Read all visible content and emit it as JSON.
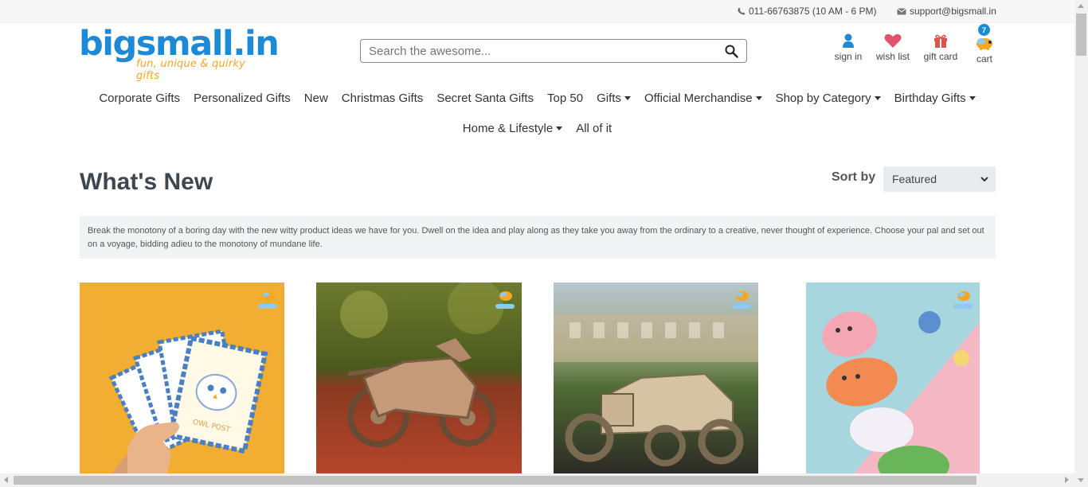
{
  "topbar": {
    "phone": "011-66763875 (10 AM - 6 PM)",
    "email": "support@bigsmall.in"
  },
  "logo": {
    "name": "bigsmall.in",
    "tagline": "fun, unique & quirky gifts"
  },
  "search": {
    "placeholder": "Search the awesome..."
  },
  "header_icons": {
    "sign_in": "sign in",
    "wish_list": "wish list",
    "gift_card": "gift card",
    "cart": "cart",
    "cart_count": "7"
  },
  "nav": {
    "row1": [
      {
        "label": "Corporate Gifts",
        "dropdown": false
      },
      {
        "label": "Personalized Gifts",
        "dropdown": false
      },
      {
        "label": "New",
        "dropdown": false
      },
      {
        "label": "Christmas Gifts",
        "dropdown": false
      },
      {
        "label": "Secret Santa Gifts",
        "dropdown": false
      },
      {
        "label": "Top 50",
        "dropdown": false
      },
      {
        "label": "Gifts",
        "dropdown": true
      },
      {
        "label": "Official Merchandise",
        "dropdown": true
      },
      {
        "label": "Shop by Category",
        "dropdown": true
      },
      {
        "label": "Birthday Gifts",
        "dropdown": true
      }
    ],
    "row2": [
      {
        "label": "Home & Lifestyle",
        "dropdown": true
      },
      {
        "label": "All of it",
        "dropdown": false
      }
    ]
  },
  "page": {
    "title": "What's New",
    "sort_label": "Sort by",
    "sort_value": "Featured",
    "description": "Break the monotony of a boring day with the new witty product ideas we have for you. Dwell on the idea and play along as they take you away from the ordinary to a creative, never thought of experience. Choose your pal and set out on a voyage, bidding adieu to the monotony of mundane life."
  },
  "products": [
    {
      "image": "postcards-owl-post",
      "card_text": "OWL POST"
    },
    {
      "image": "wooden-motorcycle-model"
    },
    {
      "image": "wooden-vintage-car-model"
    },
    {
      "image": "animal-plush-pillows"
    }
  ],
  "colors": {
    "brand_blue": "#1e8ad6",
    "brand_orange": "#f5a623",
    "heart_pink": "#e0526d",
    "gift_red": "#d9534f"
  }
}
